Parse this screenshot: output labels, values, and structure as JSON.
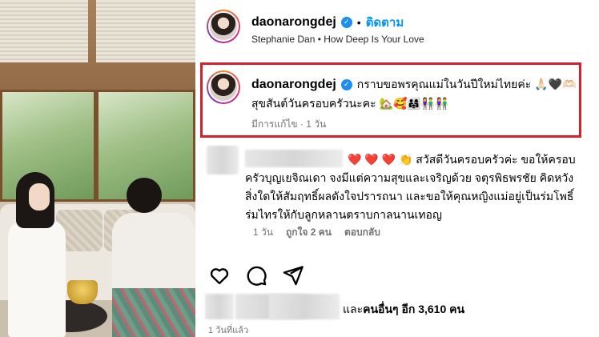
{
  "header": {
    "username": "daonarongdej",
    "separator": "•",
    "follow_label": "ติดตาม",
    "audio": "Stephanie Dan • How Deep Is Your Love",
    "verified_icon": "verified-badge-icon"
  },
  "caption": {
    "username": "daonarongdej",
    "text_line1": "กราบขอพรคุณแม่ในวันปีใหม่ไทยค่ะ 🙏🏻🖤🫶🏻",
    "text_line2": "สุขสันต์วันครอบครัวนะคะ 🏡🥰👨‍👩‍👧👫👫",
    "meta": "มีการแก้ไข · 1 วัน",
    "highlight_color": "#d3212d"
  },
  "comment": {
    "emoji_prefix": "❤️ ❤️ ❤️ 👏",
    "text": " สวัสดีวันครอบครัวค่ะ ขอให้ครอบครัวบุญเยจิณเดา จงมีแต่ความสุขและเจริญด้วย จตุรพิธพรชัย คิดหวังสิ่งใดให้สัมฤทธิ์ผลดังใจปรารถนา และขอให้คุณหญิงแม่อยู่เป็นร่มโพธิ์ร่มไทรให้กับลูกหลานตราบกาลนานเทอญ",
    "time": "1 วัน",
    "likes": "ถูกใจ 2 คน",
    "reply": "ตอบกลับ"
  },
  "actions": {
    "like_icon": "heart-outline-icon",
    "comment_icon": "comment-bubble-icon",
    "share_icon": "paper-plane-icon"
  },
  "likes": {
    "prefix": "และ",
    "others": "คนอื่นๆ อีก 3,610 คน"
  },
  "timestamp": "1 วันที่แล้ว",
  "colors": {
    "follow_blue": "#0095f6",
    "verified_blue": "#1f8ef1",
    "meta_gray": "#737373"
  }
}
